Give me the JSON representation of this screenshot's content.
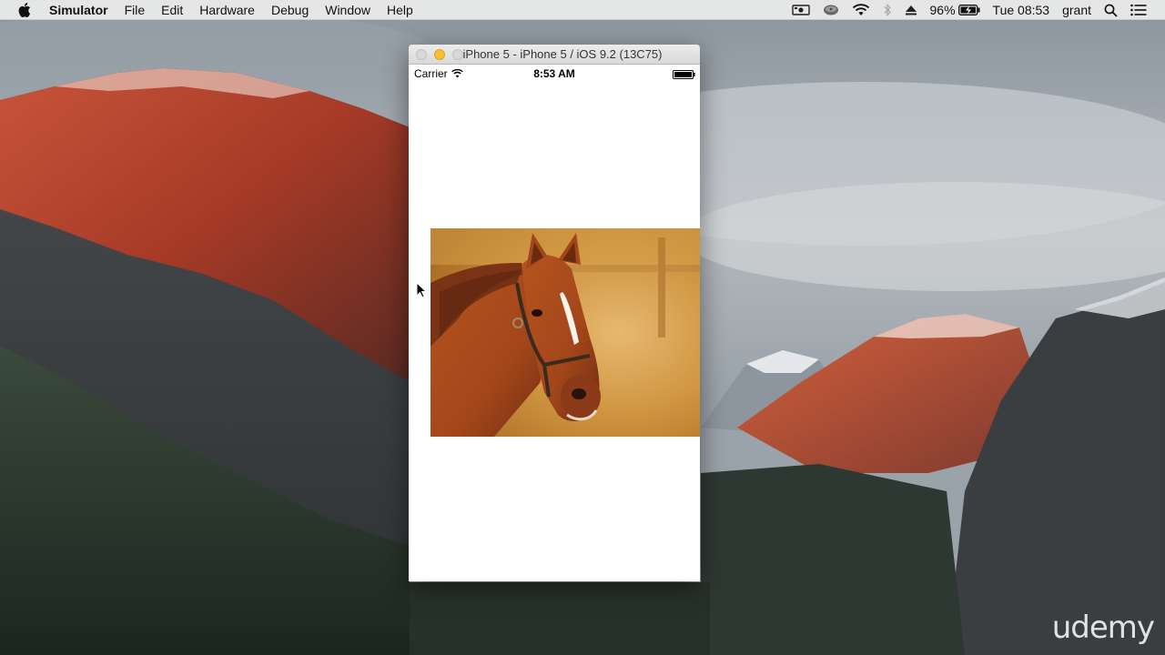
{
  "menubar": {
    "app_name": "Simulator",
    "items": [
      "File",
      "Edit",
      "Hardware",
      "Debug",
      "Window",
      "Help"
    ],
    "status": {
      "battery_percent": "96%",
      "clock": "Tue 08:53",
      "user": "grant"
    }
  },
  "simulator": {
    "window_title": "iPhone 5 - iPhone 5 / iOS 9.2 (13C75)",
    "statusbar": {
      "carrier": "Carrier",
      "time": "8:53 AM"
    },
    "image_subject": "horse-photo"
  },
  "watermark": "udemy",
  "colors": {
    "minimize_light": "#f6be30",
    "menubar_bg": "#ececec"
  }
}
